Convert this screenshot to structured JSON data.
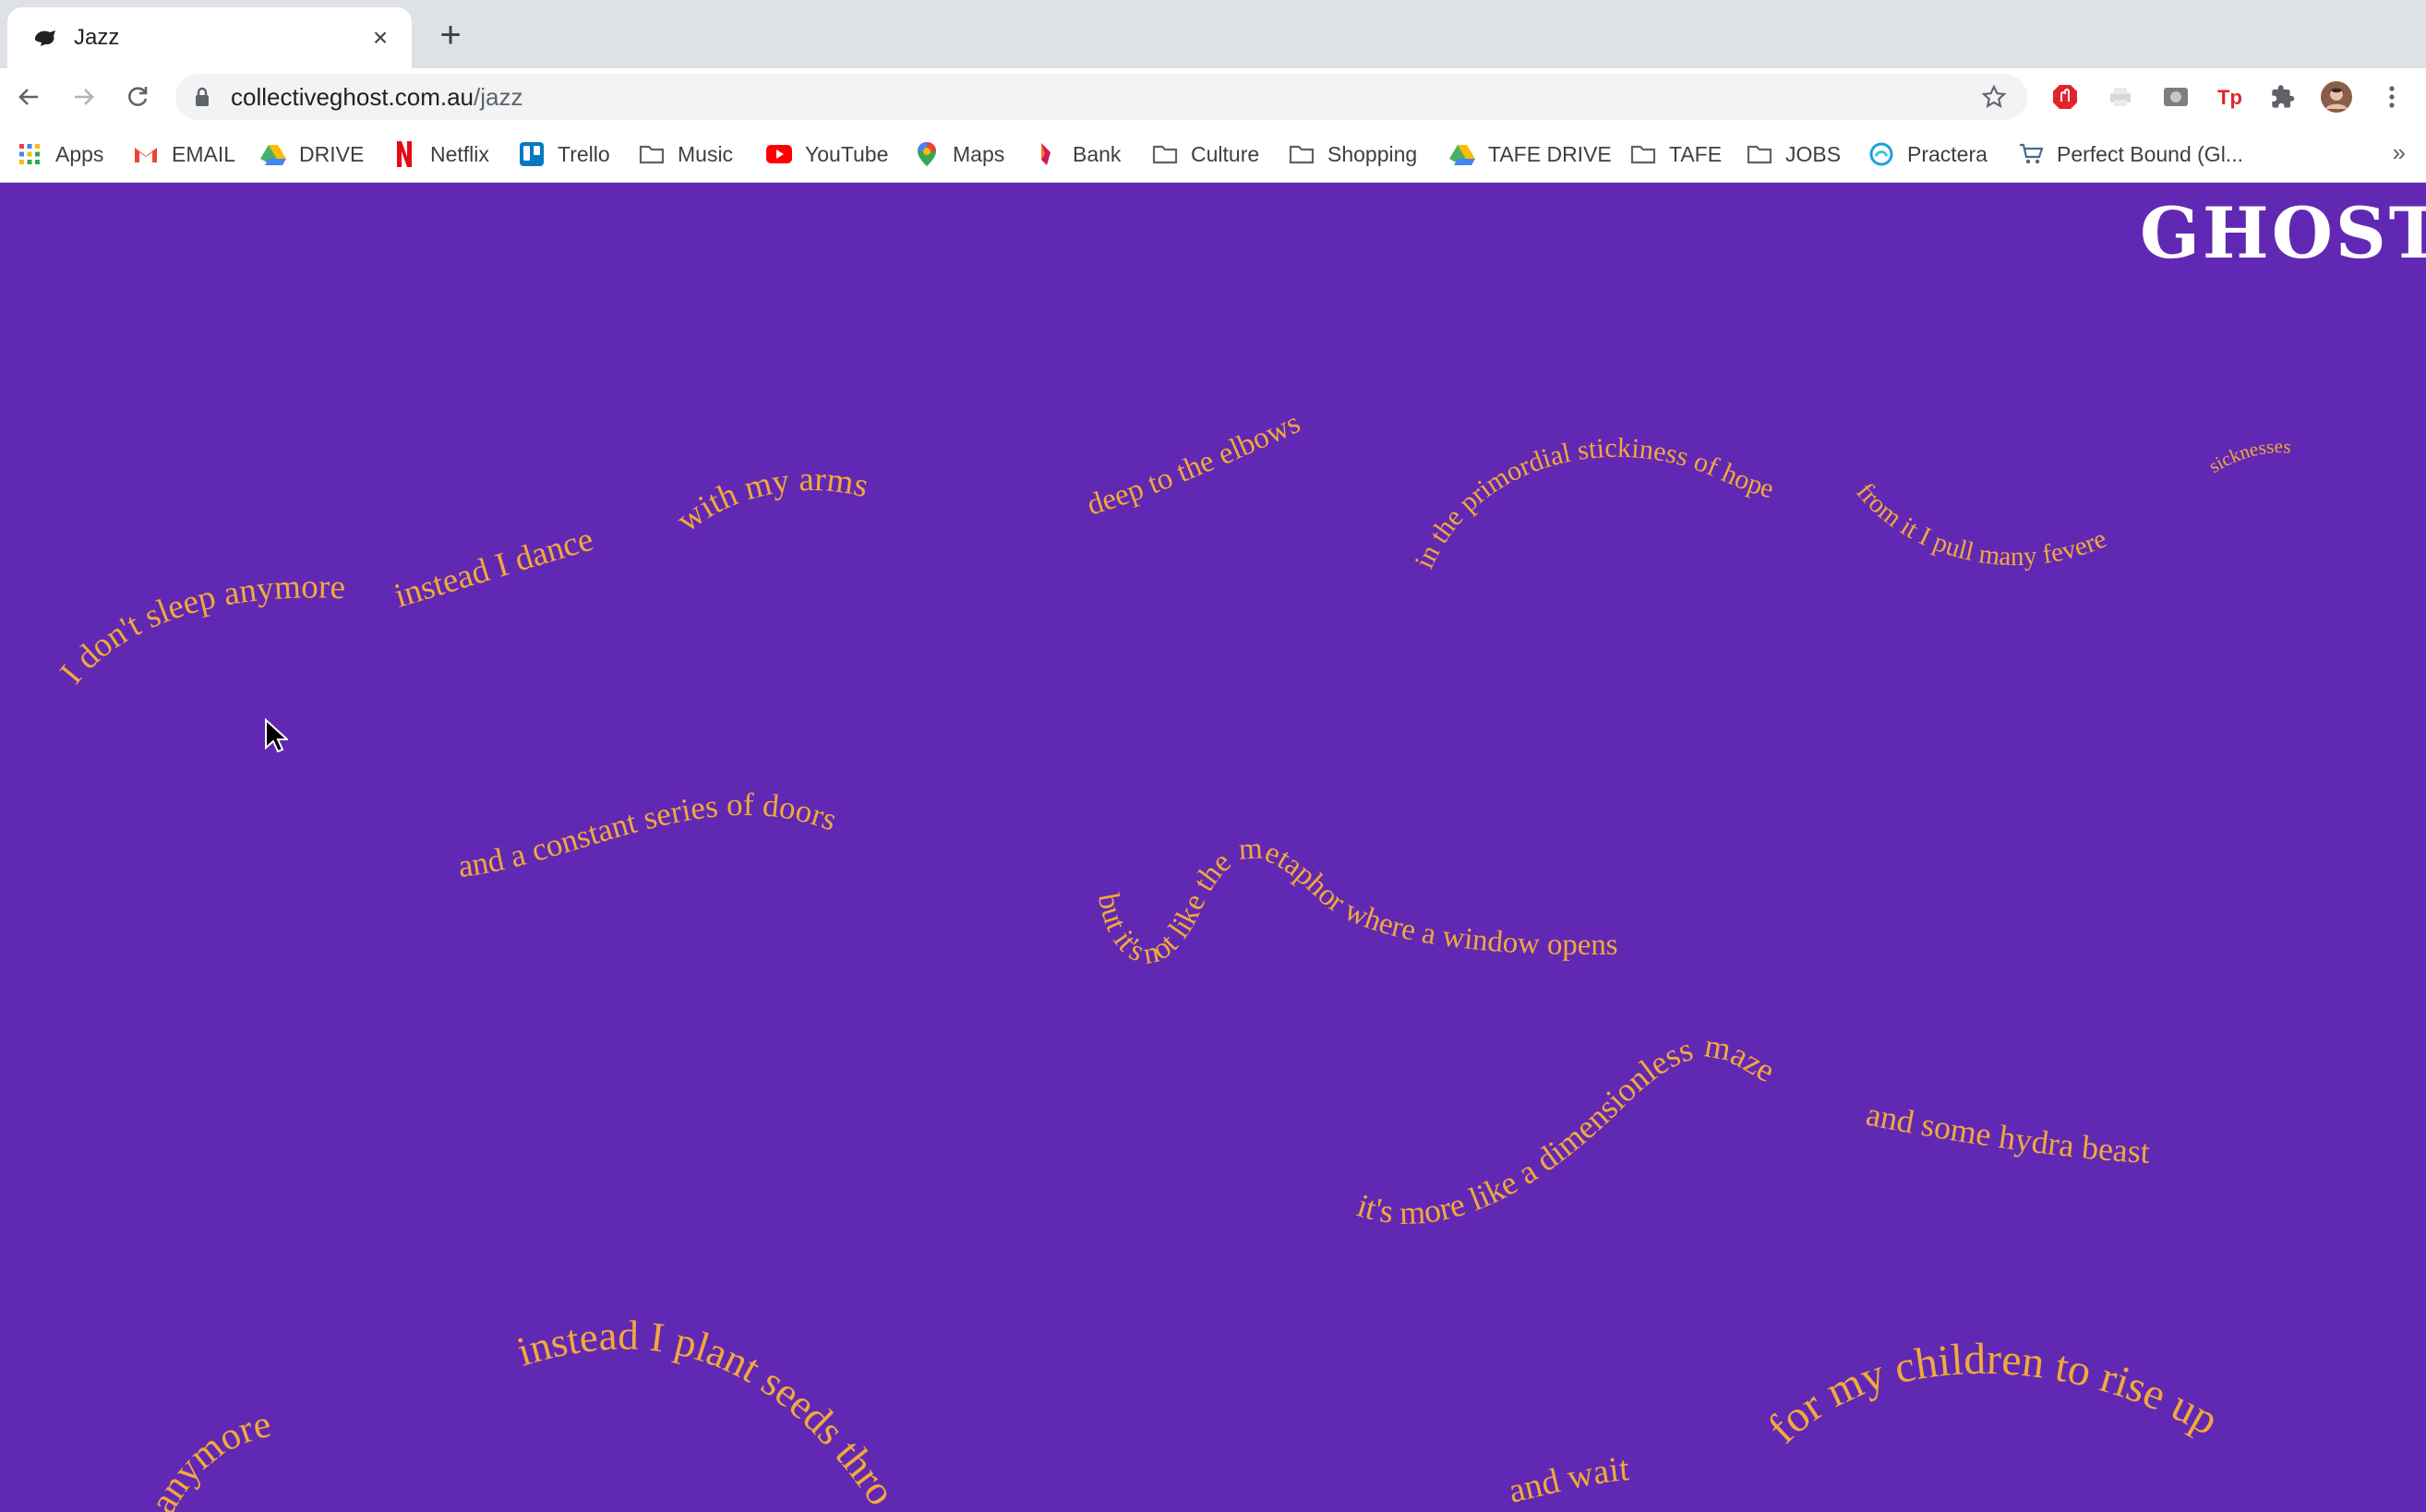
{
  "browser": {
    "tab": {
      "title": "Jazz",
      "favicon": "ghost-favicon-icon"
    },
    "new_tab_label": "+",
    "close_tab_label": "×",
    "url": {
      "domain": "collectiveghost.com.au",
      "path": "/jazz"
    },
    "bookmarks": [
      {
        "label": "Apps",
        "icon": "apps-grid-icon"
      },
      {
        "label": "EMAIL",
        "icon": "gmail-icon"
      },
      {
        "label": "DRIVE",
        "icon": "drive-icon"
      },
      {
        "label": "Netflix",
        "icon": "netflix-icon"
      },
      {
        "label": "Trello",
        "icon": "trello-icon"
      },
      {
        "label": "Music",
        "icon": "folder-icon"
      },
      {
        "label": "YouTube",
        "icon": "youtube-icon"
      },
      {
        "label": "Maps",
        "icon": "maps-icon"
      },
      {
        "label": "Bank",
        "icon": "bank-icon"
      },
      {
        "label": "Culture",
        "icon": "folder-icon"
      },
      {
        "label": "Shopping",
        "icon": "folder-icon"
      },
      {
        "label": "TAFE DRIVE",
        "icon": "drive-icon"
      },
      {
        "label": "TAFE",
        "icon": "folder-icon"
      },
      {
        "label": "JOBS",
        "icon": "folder-icon"
      },
      {
        "label": "Practera",
        "icon": "practera-icon"
      },
      {
        "label": "Perfect Bound (Gl...",
        "icon": "cart-icon"
      }
    ],
    "bookmarks_overflow": "»"
  },
  "page": {
    "logo": "GHOST",
    "background": "#6129b3",
    "text_color": "#f2a93b",
    "poem_lines": [
      "I don't sleep anymore",
      "instead I dance",
      "with my arms",
      "deep to the elbows",
      "in the primordial stickiness of  hope",
      "from it I pull many fevered",
      "sicknesses",
      "and a constant series of doors",
      "but it's not like the metaphor where a window opens",
      "it's more like a dimensionless maze",
      "and some hydra beast",
      "anymore",
      "instead I plant seeds throughout",
      "and wait",
      "for my children to rise up"
    ]
  }
}
